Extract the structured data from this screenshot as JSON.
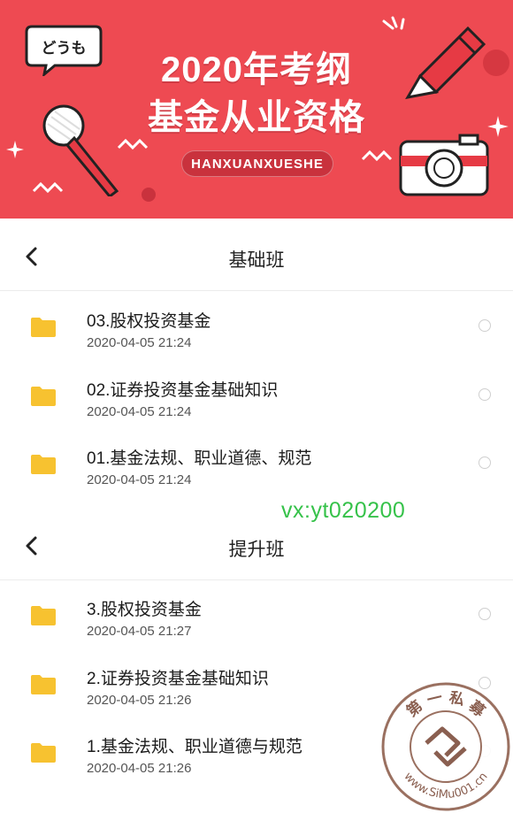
{
  "banner": {
    "bubble_text": "どうも",
    "title_line1": "2020年考纲",
    "title_line2": "基金从业资格",
    "subtitle": "HANXUANXUESHE"
  },
  "sections": [
    {
      "title": "基础班",
      "items": [
        {
          "name": "03.股权投资基金",
          "date": "2020-04-05 21:24"
        },
        {
          "name": "02.证券投资基金基础知识",
          "date": "2020-04-05 21:24"
        },
        {
          "name": "01.基金法规、职业道德、规范",
          "date": "2020-04-05 21:24"
        }
      ]
    },
    {
      "title": "提升班",
      "items": [
        {
          "name": "3.股权投资基金",
          "date": "2020-04-05 21:27"
        },
        {
          "name": "2.证券投资基金基础知识",
          "date": "2020-04-05 21:26"
        },
        {
          "name": "1.基金法规、职业道德与规范",
          "date": "2020-04-05 21:26"
        }
      ]
    }
  ],
  "overlay_text": "vx:yt020200",
  "seal": {
    "top_text": "第 一 私 募",
    "bottom_text": "www.SiMu001.cn"
  },
  "colors": {
    "banner_red": "#ee4a52",
    "folder_yellow": "#f7c230",
    "overlay_green": "#36c24a"
  }
}
